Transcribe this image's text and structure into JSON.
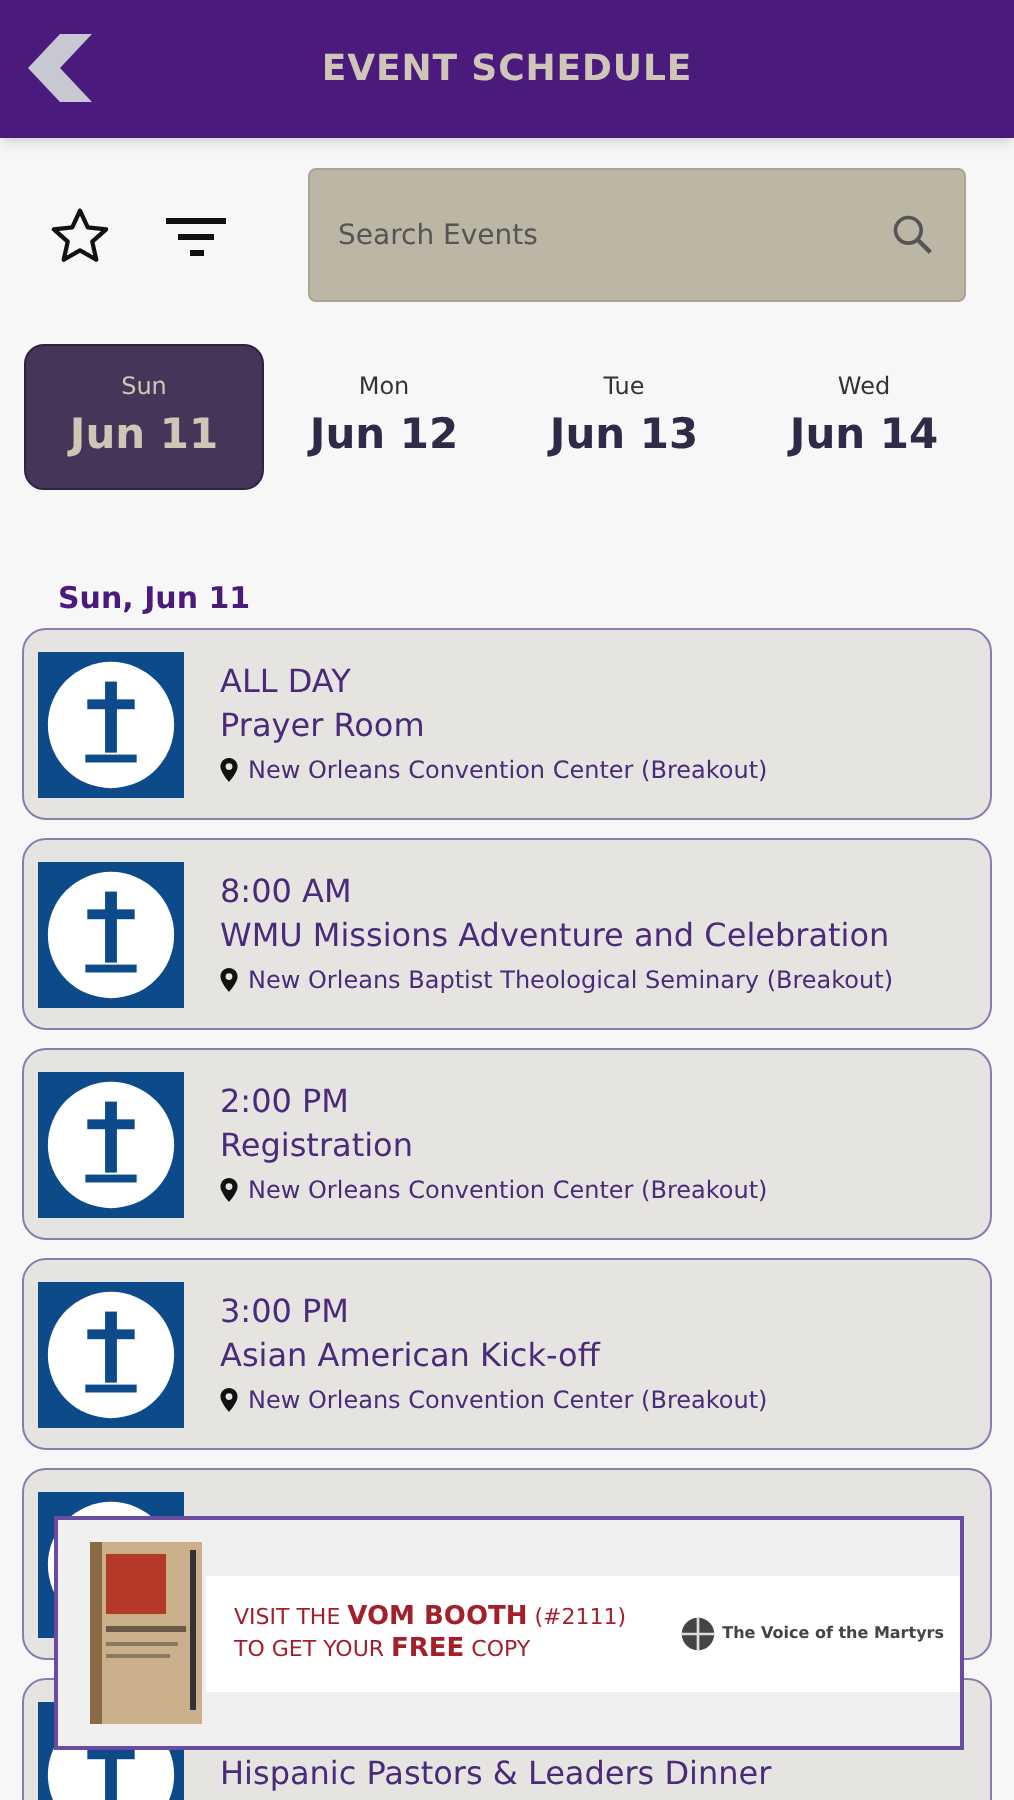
{
  "header": {
    "title": "EVENT SCHEDULE"
  },
  "search": {
    "placeholder": "Search Events"
  },
  "days": [
    {
      "weekday": "Sun",
      "date": "Jun 11",
      "selected": true
    },
    {
      "weekday": "Mon",
      "date": "Jun 12",
      "selected": false
    },
    {
      "weekday": "Tue",
      "date": "Jun 13",
      "selected": false
    },
    {
      "weekday": "Wed",
      "date": "Jun 14",
      "selected": false
    }
  ],
  "section_heading": "Sun, Jun 11",
  "events": [
    {
      "time": "ALL DAY",
      "title": "Prayer Room",
      "location": "New Orleans Convention Center (Breakout)"
    },
    {
      "time": "8:00 AM",
      "title": "WMU Missions Adventure and Celebration",
      "location": "New Orleans Baptist Theological Seminary (Breakout)"
    },
    {
      "time": "2:00 PM",
      "title": "Registration",
      "location": "New Orleans Convention Center (Breakout)"
    },
    {
      "time": "3:00 PM",
      "title": "Asian American Kick-off",
      "location": "New Orleans Convention Center (Breakout)"
    },
    {
      "title": "Hispanic Pastors & Leaders Dinner"
    }
  ],
  "ad": {
    "lines": [
      "VISIT THE **VOM BOOTH** (#2111)",
      "TO GET YOUR **FREE** COPY"
    ],
    "logo": "The Voice of the Martyrs"
  }
}
